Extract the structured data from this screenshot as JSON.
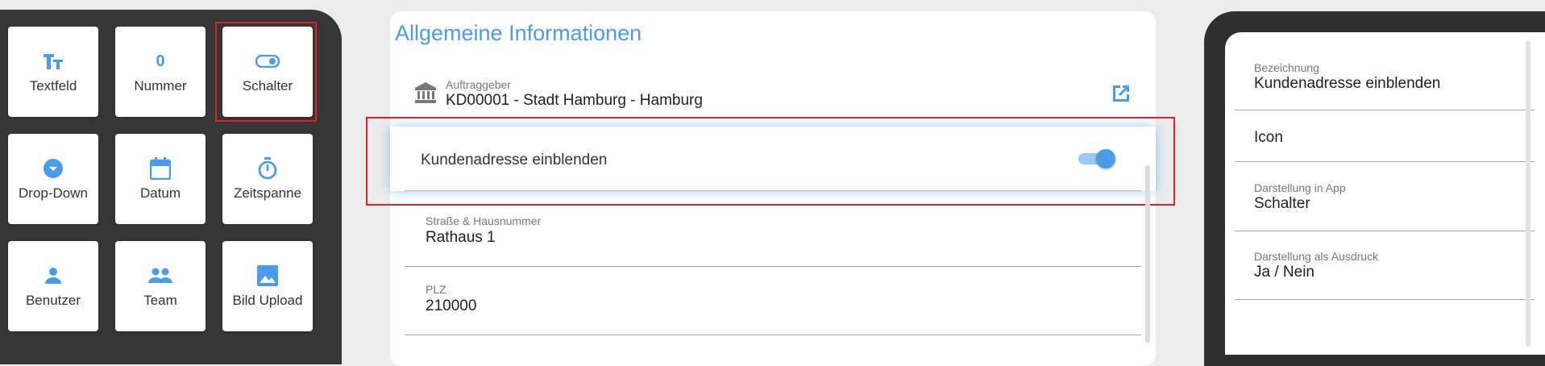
{
  "palette": {
    "tiles": [
      {
        "label": "Textfeld",
        "icon": "text-format-icon"
      },
      {
        "label": "Nummer",
        "icon": "number-icon",
        "glyph": "0"
      },
      {
        "label": "Schalter",
        "icon": "toggle-icon",
        "highlighted": true
      },
      {
        "label": "Drop-Down",
        "icon": "dropdown-icon"
      },
      {
        "label": "Datum",
        "icon": "calendar-icon"
      },
      {
        "label": "Zeitspanne",
        "icon": "timer-icon"
      },
      {
        "label": "Benutzer",
        "icon": "person-icon"
      },
      {
        "label": "Team",
        "icon": "group-icon"
      },
      {
        "label": "Bild Upload",
        "icon": "image-icon"
      }
    ]
  },
  "form": {
    "section_title": "Allgemeine Informationen",
    "client": {
      "label": "Auftraggeber",
      "value": "KD00001 - Stadt Hamburg - Hamburg",
      "icon": "bank-icon",
      "action_icon": "open-external-icon"
    },
    "toggle": {
      "label": "Kundenadresse einblenden",
      "checked": true
    },
    "fields": [
      {
        "label": "Straße & Hausnummer",
        "value": "Rathaus 1"
      },
      {
        "label": "PLZ",
        "value": "210000"
      }
    ]
  },
  "properties": {
    "items": [
      {
        "label": "Bezeichnung",
        "value": "Kundenadresse einblenden"
      },
      {
        "label": "",
        "value": "Icon"
      },
      {
        "label": "Darstellung in App",
        "value": "Schalter"
      },
      {
        "label": "Darstellung als Ausdruck",
        "value": "Ja / Nein"
      }
    ]
  },
  "colors": {
    "accent": "#4a9be8",
    "highlight_border": "#e0202a",
    "panel_dark": "#363636"
  }
}
